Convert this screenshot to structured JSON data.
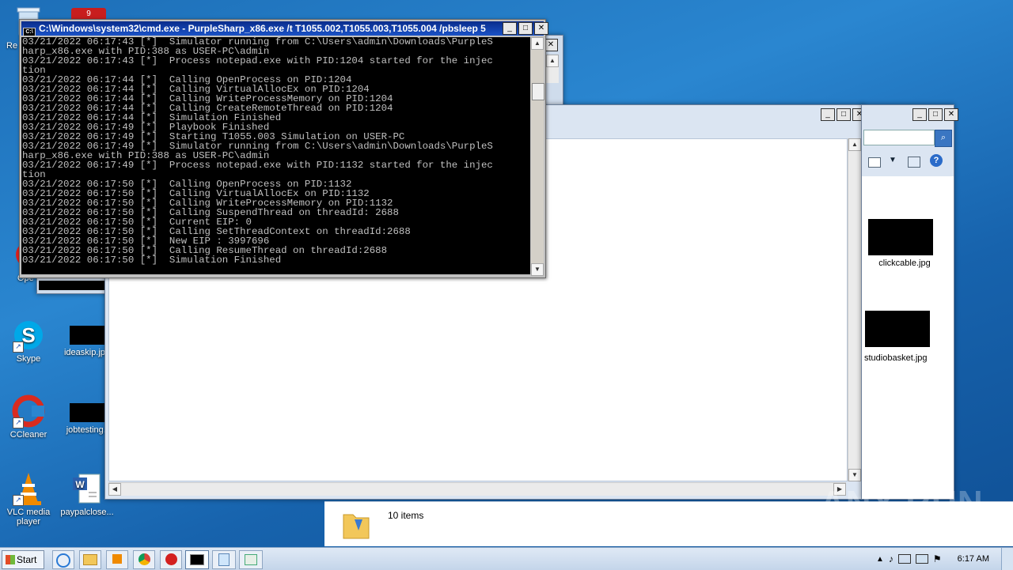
{
  "desktop": {
    "icons": [
      {
        "label": "Re",
        "name": "recycle-bin"
      },
      {
        "label": "Skype",
        "name": "skype"
      },
      {
        "label": "ideaskip.jpg",
        "name": "ideaskip-file"
      },
      {
        "label": "CCleaner",
        "name": "ccleaner"
      },
      {
        "label": "jobtesting.j",
        "name": "jobtesting-file"
      },
      {
        "label": "VLC media player",
        "name": "vlc"
      },
      {
        "label": "paypalclose...",
        "name": "paypalclose-file"
      },
      {
        "label": "Ope",
        "name": "opera"
      }
    ]
  },
  "cmd": {
    "title": "C:\\Windows\\system32\\cmd.exe - PurpleSharp_x86.exe  /t T1055.002,T1055.003,T1055.004 /pbsleep 5",
    "lines": [
      "03/21/2022 06:17:43 [*]  Simulator running from C:\\Users\\admin\\Downloads\\PurpleS",
      "harp_x86.exe with PID:388 as USER-PC\\admin",
      "03/21/2022 06:17:43 [*]  Process notepad.exe with PID:1204 started for the injec",
      "tion",
      "03/21/2022 06:17:44 [*]  Calling OpenProcess on PID:1204",
      "03/21/2022 06:17:44 [*]  Calling VirtualAllocEx on PID:1204",
      "03/21/2022 06:17:44 [*]  Calling WriteProcessMemory on PID:1204",
      "03/21/2022 06:17:44 [*]  Calling CreateRemoteThread on PID:1204",
      "03/21/2022 06:17:44 [*]  Simulation Finished",
      "03/21/2022 06:17:49 [*]  Playbook Finished",
      "03/21/2022 06:17:49 [*]  Starting T1055.003 Simulation on USER-PC",
      "03/21/2022 06:17:49 [*]  Simulator running from C:\\Users\\admin\\Downloads\\PurpleS",
      "harp_x86.exe with PID:388 as USER-PC\\admin",
      "03/21/2022 06:17:49 [*]  Process notepad.exe with PID:1132 started for the injec",
      "tion",
      "03/21/2022 06:17:50 [*]  Calling OpenProcess on PID:1132",
      "03/21/2022 06:17:50 [*]  Calling VirtualAllocEx on PID:1132",
      "03/21/2022 06:17:50 [*]  Calling WriteProcessMemory on PID:1132",
      "03/21/2022 06:17:50 [*]  Calling SuspendThread on threadId: 2688",
      "03/21/2022 06:17:50 [*]  Current EIP: 0",
      "03/21/2022 06:17:50 [*]  Calling SetThreadContext on threadId:2688",
      "03/21/2022 06:17:50 [*]  New EIP : 3997696",
      "03/21/2022 06:17:50 [*]  Calling ResumeThread on threadId:2688",
      "03/21/2022 06:17:50 [*]  Simulation Finished"
    ]
  },
  "explorer": {
    "files": [
      {
        "label": "clickcable.jpg"
      },
      {
        "label": "studiobasket.jpg"
      }
    ],
    "status": "10 items"
  },
  "taskbar": {
    "start_label": "Start",
    "clock": "6:17 AM"
  },
  "watermark": "ANY RUN"
}
